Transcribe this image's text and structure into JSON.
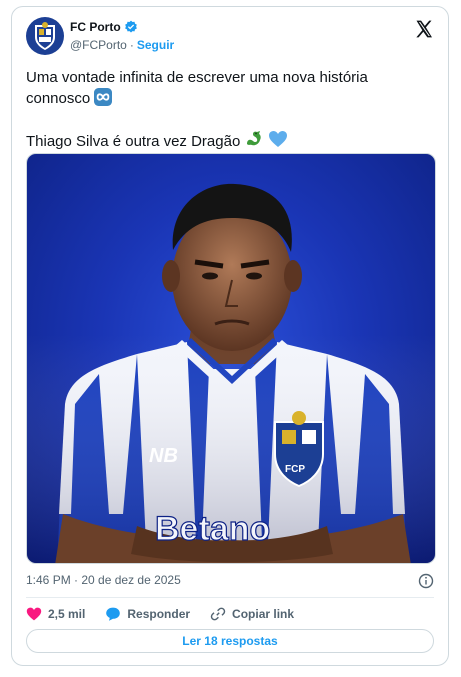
{
  "account": {
    "name": "FC Porto",
    "handle": "@FCPorto",
    "separator": "·",
    "follow_label": "Seguir",
    "verified": true
  },
  "tweet": {
    "line1": "Uma vontade infinita de escrever uma nova história connosco",
    "line2": "Thiago Silva é outra vez Dragão"
  },
  "photo": {
    "shirt_brand": "NB",
    "sponsor": "Betano",
    "crest": "FCP"
  },
  "meta": {
    "timestamp": "1:46 PM · 20 de dez de 2025"
  },
  "actions": {
    "likes": "2,5 mil",
    "reply_label": "Responder",
    "copy_label": "Copiar link"
  },
  "read_replies_label": "Ler 18 respostas",
  "colors": {
    "accent": "#1d9bf0",
    "like": "#f91880",
    "porto_blue": "#1c3f94"
  },
  "icons": [
    "porto-crest-icon",
    "verified-badge-icon",
    "x-logo-icon",
    "infinity-emoji-icon",
    "dragon-emoji-icon",
    "blue-heart-emoji-icon",
    "info-icon",
    "heart-icon",
    "reply-bubble-icon",
    "link-icon"
  ]
}
